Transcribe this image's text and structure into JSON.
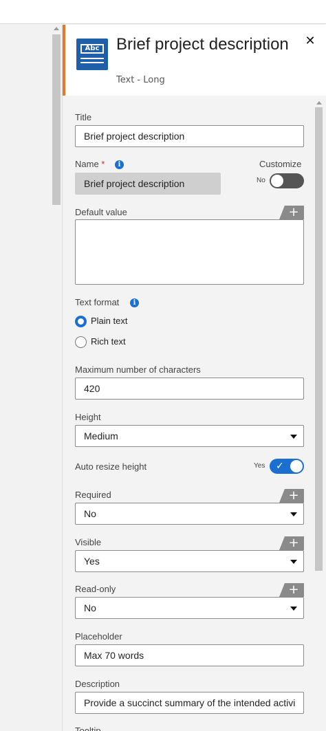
{
  "header": {
    "title": "Brief project description",
    "subtitle": "Text - Long",
    "icon_text": "Abc"
  },
  "fields": {
    "title": {
      "label": "Title",
      "value": "Brief project description"
    },
    "name": {
      "label": "Name",
      "required_mark": "*",
      "value": "Brief project description"
    },
    "customize": {
      "label": "Customize",
      "state": "No"
    },
    "default_value": {
      "label": "Default value",
      "value": ""
    },
    "text_format": {
      "label": "Text format",
      "options": [
        "Plain text",
        "Rich text"
      ],
      "selected": "Plain text"
    },
    "max_chars": {
      "label": "Maximum number of characters",
      "value": "420"
    },
    "height": {
      "label": "Height",
      "value": "Medium"
    },
    "auto_resize": {
      "label": "Auto resize height",
      "state": "Yes"
    },
    "required": {
      "label": "Required",
      "value": "No"
    },
    "visible": {
      "label": "Visible",
      "value": "Yes"
    },
    "read_only": {
      "label": "Read-only",
      "value": "No"
    },
    "placeholder": {
      "label": "Placeholder",
      "value": "Max 70 words"
    },
    "description": {
      "label": "Description",
      "value": "Provide a succinct summary of the intended activi"
    },
    "tooltip": {
      "label": "Tooltip"
    }
  },
  "icons": {
    "plus": "+",
    "close": "✕",
    "info": "i",
    "check": "✓"
  },
  "colors": {
    "accent": "#e8772e",
    "brand": "#1f5ea8",
    "primary": "#1a6fd1",
    "required": "#d12b2b"
  }
}
